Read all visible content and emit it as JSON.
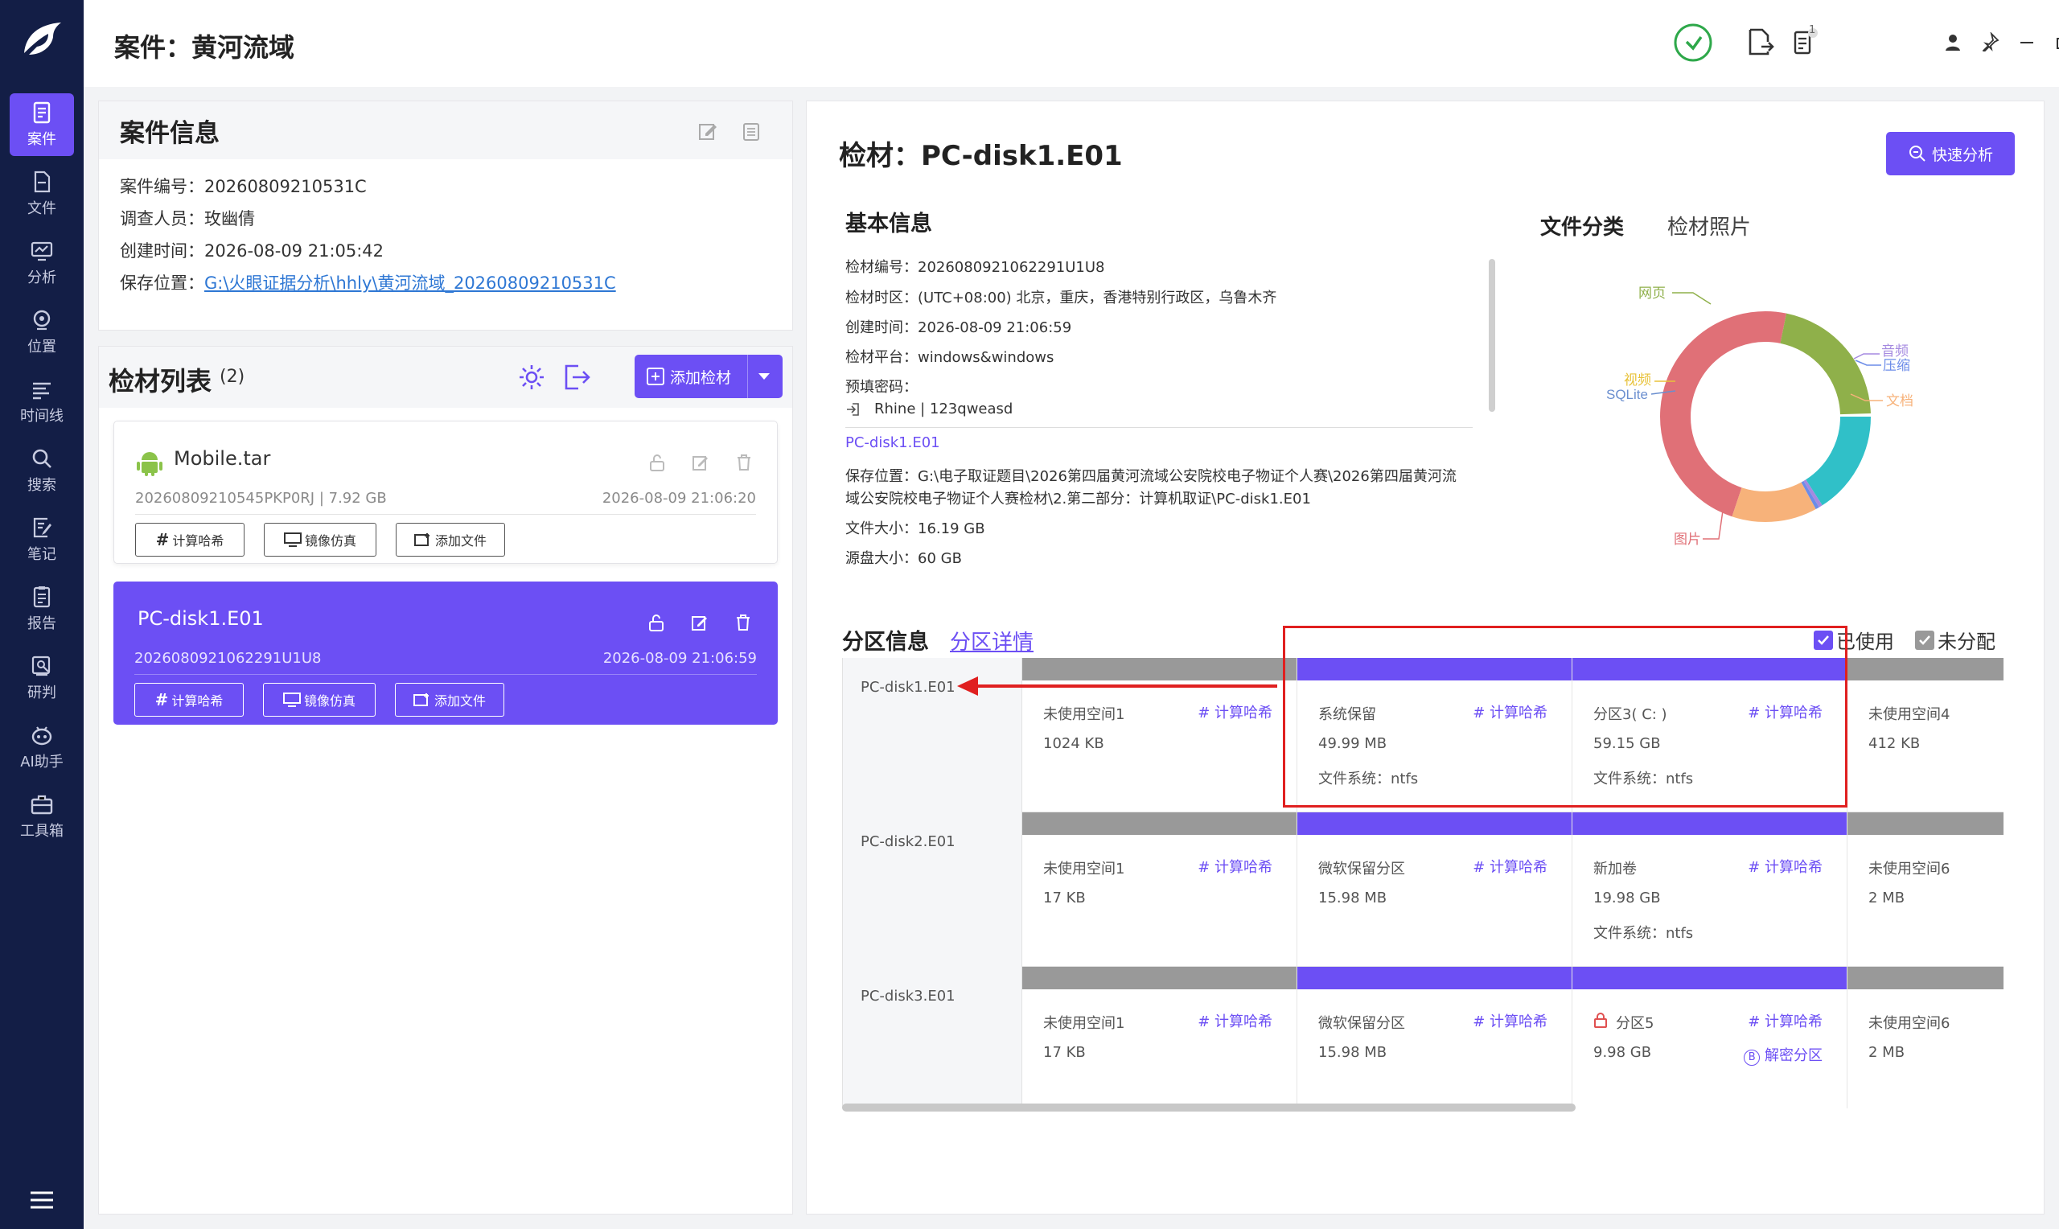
{
  "nav": [
    {
      "label": "案件",
      "icon": "case-icon"
    },
    {
      "label": "文件",
      "icon": "file-icon"
    },
    {
      "label": "分析",
      "icon": "analysis-icon"
    },
    {
      "label": "位置",
      "icon": "location-icon"
    },
    {
      "label": "时间线",
      "icon": "timeline-icon"
    },
    {
      "label": "搜索",
      "icon": "search-icon"
    },
    {
      "label": "笔记",
      "icon": "notes-icon"
    },
    {
      "label": "报告",
      "icon": "report-icon"
    },
    {
      "label": "研判",
      "icon": "judge-icon"
    },
    {
      "label": "AI助手",
      "icon": "ai-assistant-icon"
    },
    {
      "label": "工具箱",
      "icon": "toolbox-icon"
    }
  ],
  "header": {
    "title": "案件：黄河流域",
    "task_badge": "1"
  },
  "case_info": {
    "title": "案件信息",
    "fields": [
      {
        "label": "案件编号：",
        "value": "20260809210531C"
      },
      {
        "label": "调查人员：",
        "value": "玫幽倩"
      },
      {
        "label": "创建时间：",
        "value": "2026-08-09 21:05:42"
      },
      {
        "label": "保存位置：",
        "value": "G:\\火眼证据分析\\hhly\\黄河流域_20260809210531C"
      }
    ]
  },
  "evidence_list": {
    "title": "检材列表",
    "count": "(2)",
    "add_button": "添加检材",
    "items": [
      {
        "name": "Mobile.tar",
        "meta": "20260809210545PKP0RJ | 7.92 GB",
        "date": "2026-08-09 21:06:20",
        "selected": false
      },
      {
        "name": "PC-disk1.E01",
        "meta": "2026080921062291U1U8",
        "date": "2026-08-09 21:06:59",
        "selected": true
      }
    ],
    "btn_hash": "计算哈希",
    "btn_mirror": "镜像仿真",
    "btn_addfile": "添加文件"
  },
  "evidence": {
    "title": "检材：PC-disk1.E01",
    "quick_button": "快速分析",
    "basic_title": "基本信息",
    "basic": [
      "检材编号：2026080921062291U1U8",
      "检材时区：(UTC+08:00) 北京，重庆，香港特别行政区，乌鲁木齐",
      "创建时间：2026-08-09 21:06:59",
      "检材平台：windows&windows",
      "预填密码：",
      "Rhine | 123qweasd"
    ],
    "file_name": "PC-disk1.E01",
    "save_path_1": "保存位置：G:\\电子取证题目\\2026第四届黄河流域公安院校电子物证个人赛\\2026第四届黄河流",
    "save_path_2": "域公安院校电子物证个人赛检材\\2.第二部分：计算机取证\\PC-disk1.E01",
    "file_size": "文件大小：16.19 GB",
    "source_size": "源盘大小：60 GB",
    "tab_classification": "文件分类",
    "tab_photo": "检材照片"
  },
  "pie": {
    "labels": [
      "网页",
      "音频",
      "压缩",
      "视频",
      "SQLite",
      "文档",
      "图片"
    ],
    "colors": {
      "网页": "#8fb04a",
      "音频": "#a58ae0",
      "压缩": "#6c8ce8",
      "视频": "#e8c23a",
      "SQLite": "#6a8ecf",
      "文档": "#f7b27a",
      "图片": "#e07077",
      "other": "#30c0c8"
    }
  },
  "partition": {
    "title": "分区信息",
    "link": "分区详情",
    "legend_used": "已使用",
    "legend_unalloc": "未分配",
    "hash_label": "计算哈希",
    "decrypt_label": "解密分区",
    "rows": [
      {
        "disk": "PC-disk1.E01",
        "cells": [
          {
            "name": "未使用空间1",
            "size": "1024 KB",
            "fs": "",
            "used": false
          },
          {
            "name": "系统保留",
            "size": "49.99 MB",
            "fs": "文件系统：ntfs",
            "used": true
          },
          {
            "name": "分区3( C: )",
            "size": "59.15 GB",
            "fs": "文件系统：ntfs",
            "used": true
          },
          {
            "name": "未使用空间4",
            "size": "412 KB",
            "fs": "",
            "used": false
          }
        ]
      },
      {
        "disk": "PC-disk2.E01",
        "cells": [
          {
            "name": "未使用空间1",
            "size": "17 KB",
            "fs": "",
            "used": false
          },
          {
            "name": "微软保留分区",
            "size": "15.98 MB",
            "fs": "",
            "used": true
          },
          {
            "name": "新加卷",
            "size": "19.98 GB",
            "fs": "文件系统：ntfs",
            "used": true
          },
          {
            "name": "未使用空间6",
            "size": "2 MB",
            "fs": "",
            "used": false
          }
        ]
      },
      {
        "disk": "PC-disk3.E01",
        "cells": [
          {
            "name": "未使用空间1",
            "size": "17 KB",
            "fs": "",
            "used": false
          },
          {
            "name": "微软保留分区",
            "size": "15.98 MB",
            "fs": "",
            "used": true
          },
          {
            "name": "分区5",
            "size": "9.98 GB",
            "fs": "",
            "used": true,
            "locked": true
          },
          {
            "name": "未使用空间6",
            "size": "2 MB",
            "fs": "",
            "used": false
          }
        ]
      }
    ]
  },
  "colors": {
    "accent": "#6c4ff4",
    "sidebar": "#131e46",
    "annotation": "#e02020"
  }
}
